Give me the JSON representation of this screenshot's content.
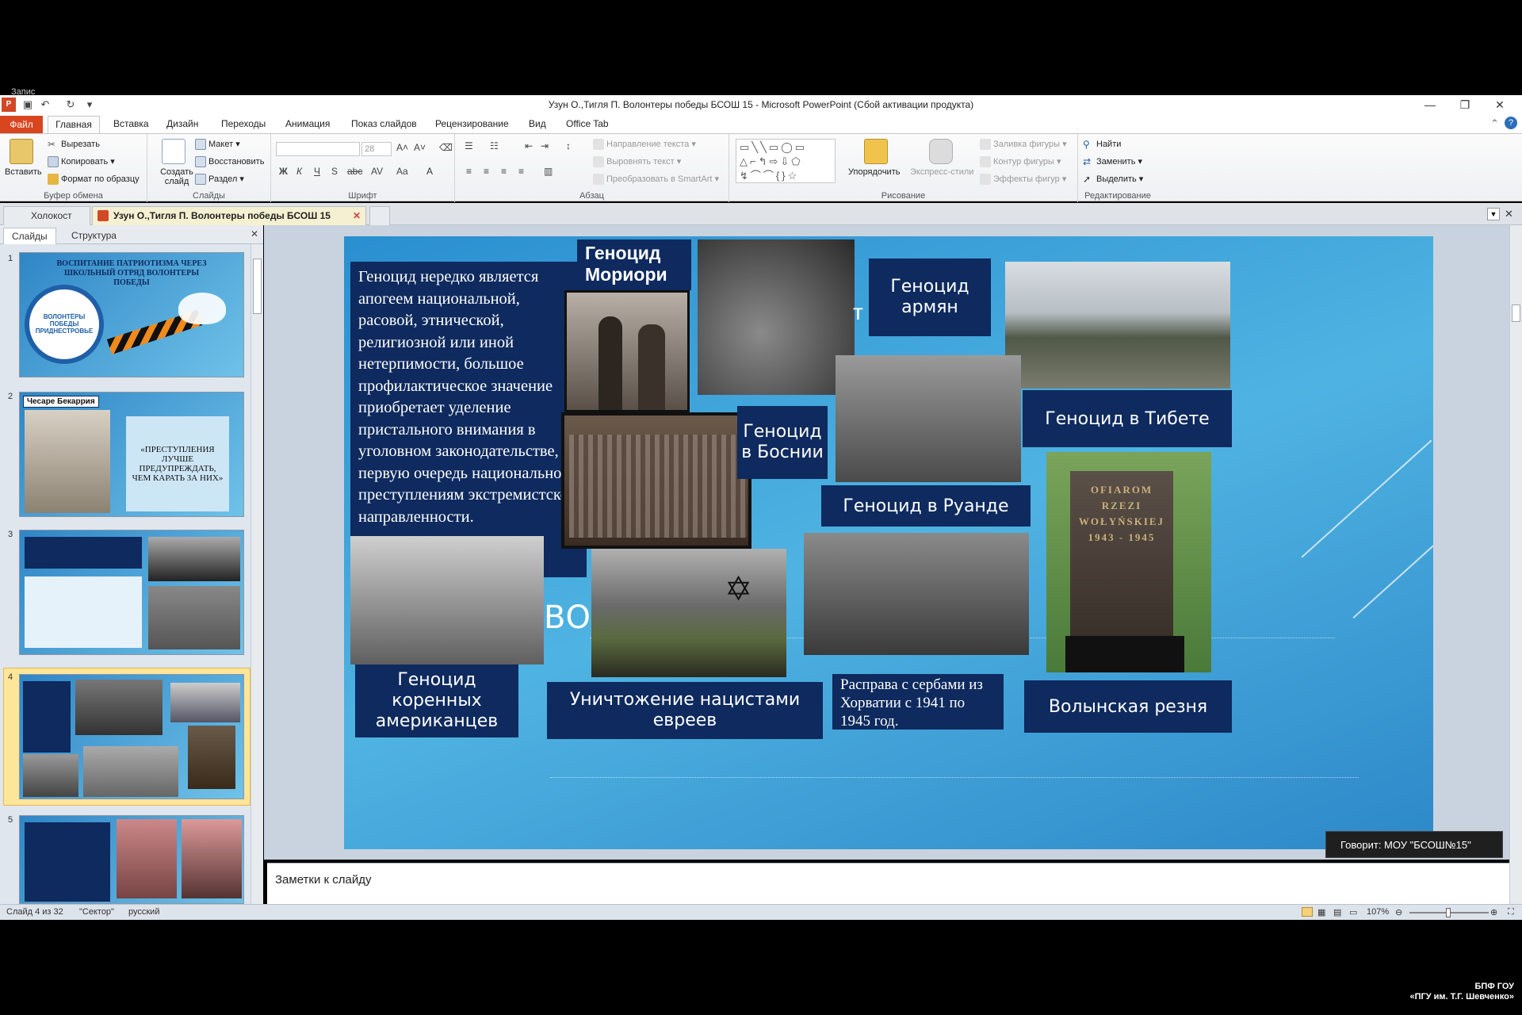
{
  "window": {
    "title": "Узун О.,Тигля П. Волонтеры победы БСОШ 15  -  Microsoft PowerPoint (Сбой активации продукта)",
    "top_overlay": "Запис"
  },
  "ribbon_tabs": [
    "Файл",
    "Главная",
    "Вставка",
    "Дизайн",
    "Переходы",
    "Анимация",
    "Показ слайдов",
    "Рецензирование",
    "Вид",
    "Office Tab"
  ],
  "ribbon": {
    "clipboard": {
      "label": "Буфер обмена",
      "paste": "Вставить",
      "cut": "Вырезать",
      "copy": "Копировать",
      "format_painter": "Формат по образцу"
    },
    "slides": {
      "label": "Слайды",
      "new_slide": "Создать слайд",
      "layout": "Макет",
      "reset": "Восстановить",
      "section": "Раздел"
    },
    "font": {
      "label": "Шрифт",
      "size": "28"
    },
    "paragraph": {
      "label": "Абзац",
      "text_direction": "Направление текста",
      "align_text": "Выровнять текст",
      "smartart": "Преобразовать в SmartArt"
    },
    "drawing": {
      "label": "Рисование",
      "arrange": "Упорядочить",
      "quick_styles": "Экспресс-стили",
      "fill": "Заливка фигуры",
      "outline": "Контур фигуры",
      "effects": "Эффекты фигур"
    },
    "editing": {
      "label": "Редактирование",
      "find": "Найти",
      "replace": "Заменить",
      "select": "Выделить"
    }
  },
  "doc_tabs": [
    {
      "label": "Холокост",
      "active": false
    },
    {
      "label": "Узун О.,Тигля П. Волонтеры победы БСОШ 15",
      "active": true
    }
  ],
  "left_pane": {
    "tabs": [
      "Слайды",
      "Структура"
    ],
    "thumbnails": [
      {
        "num": "1",
        "text": "ВОСПИТАНИЕ ПАТРИОТИЗМА ЧЕРЕЗ ШКОЛЬНЫЙ ОТРЯД ВОЛОНТЕРЫ ПОБЕДЫ",
        "logo": "ВОЛОНТЁРЫ ПОБЕДЫ ПРИДНЕСТРОВЬЕ"
      },
      {
        "num": "2",
        "name": "Чесаре Бекаррия",
        "quote": "«ПРЕСТУПЛЕНИЯ ЛУЧШЕ ПРЕДУПРЕЖДАТЬ, ЧЕМ КАРАТЬ ЗА НИХ»"
      },
      {
        "num": "3"
      },
      {
        "num": "4",
        "selected": true
      },
      {
        "num": "5"
      }
    ]
  },
  "slide": {
    "intro_text": "Геноцид нередко является апогеем национальной, расовой, этнической, религиозной или иной нетерпимости, большое профилактическое значение приобретает уделение пристального внимания в уголовном законодательстве, в первую очередь национальном, преступлениям экстремистской направленности.",
    "moriori": "Геноцид Мориори",
    "armenians": "Геноцид армян",
    "tibet": "Геноцид в Тибете",
    "bosnia": "Геноцид в Боснии",
    "rwanda": "Геноцид в Руанде",
    "natives": "Геноцид коренных американцев",
    "jews": "Уничтожение нацистами евреев",
    "serbs": "Расправа с сербами из Хорватии с 1941  по 1945 год.",
    "volyn": "Волынская резня",
    "bg_fragment": "ВО",
    "monument_text": "OFIAROM RZEZI WOŁYŃSKIEJ 1943 - 1945"
  },
  "notes_placeholder": "Заметки к слайду",
  "speaker": "Говорит: МОУ \"БСОШ№15\"",
  "status": {
    "slide": "Слайд 4 из 32",
    "theme": "\"Сектор\"",
    "lang": "русский",
    "zoom": "107%"
  },
  "watermark": [
    "БПФ ГОУ",
    "«ПГУ им. Т.Г. Шевченко»"
  ],
  "colors": {
    "slide_navy": "#0e2a5e",
    "file_tab": "#d9451f",
    "slide_blue": "#3fa6dc"
  }
}
